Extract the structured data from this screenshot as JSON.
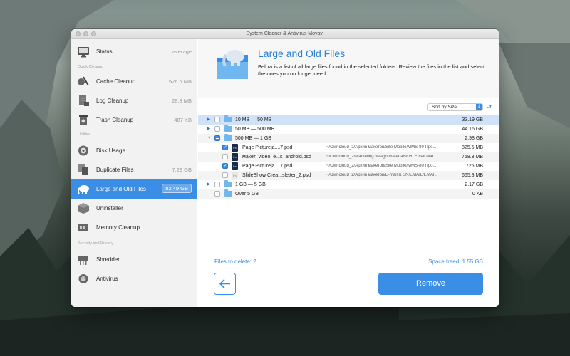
{
  "window": {
    "title": "System Cleaner & Antivirus Movavi"
  },
  "sidebar": {
    "status": {
      "label": "Status",
      "value": "average"
    },
    "sections": {
      "quick_cleanup": "Quick Cleanup",
      "utilities": "Utilities",
      "security": "Security and Privacy"
    },
    "items": [
      {
        "label": "Cache Cleanup",
        "value": "526.5 MB"
      },
      {
        "label": "Log Cleanup",
        "value": "28.3 MB"
      },
      {
        "label": "Trash Cleanup",
        "value": "487 KB"
      },
      {
        "label": "Disk Usage",
        "value": ""
      },
      {
        "label": "Duplicate Files",
        "value": "7.29 GB"
      },
      {
        "label": "Large and Old Files",
        "value": "82.49 GB"
      },
      {
        "label": "Uninstaller",
        "value": ""
      },
      {
        "label": "Memory Cleanup",
        "value": ""
      },
      {
        "label": "Shredder",
        "value": ""
      },
      {
        "label": "Antivirus",
        "value": ""
      }
    ]
  },
  "header": {
    "title": "Large and Old Files",
    "description": "Below is a list of all large files found in the selected folders. Review the files in the list and select the ones you no longer need."
  },
  "sort": {
    "label": "Sort by Size"
  },
  "rows": [
    {
      "name": "10 MB — 50 MB",
      "size": "33.19 GB"
    },
    {
      "name": "50 MB — 500 MB",
      "size": "44.16 GB"
    },
    {
      "name": "500 MB — 1 GB",
      "size": "2.98 GB"
    },
    {
      "name": "Page Pictureja....7.psd",
      "path": "~/Owncloud_2/Архив макетов/Site Mobile/MMS-80 Про...",
      "size": "825.5 MB"
    },
    {
      "name": "макет_video_e...s_android.psd",
      "path": "~/Owncloud_2/Marketing design materials/05. Email Mar...",
      "size": "758.3 MB"
    },
    {
      "name": "Page Pictureja....7.psd",
      "path": "~/Owncloud_2/Архив макетов/Site Mobile/MMS-80 Про...",
      "size": "726 MB"
    },
    {
      "name": "SlideShow Crea...sletter_2.psd",
      "path": "~/Owncloud_2/Архив макетов/E-mail & SN/EMAIL/EMAI...",
      "size": "665.8 MB"
    },
    {
      "name": "1 GB — 5 GB",
      "size": "2.17 GB"
    },
    {
      "name": "Over 5 GB",
      "size": "0 KB"
    }
  ],
  "footer": {
    "files_to_delete": "Files to delete: 2",
    "space_freed": "Space freed: 1.55 GB",
    "remove_label": "Remove"
  },
  "colors": {
    "accent": "#3a8ee6",
    "selected_row": "#cfe2f8",
    "folder": "#6fb7ee"
  }
}
